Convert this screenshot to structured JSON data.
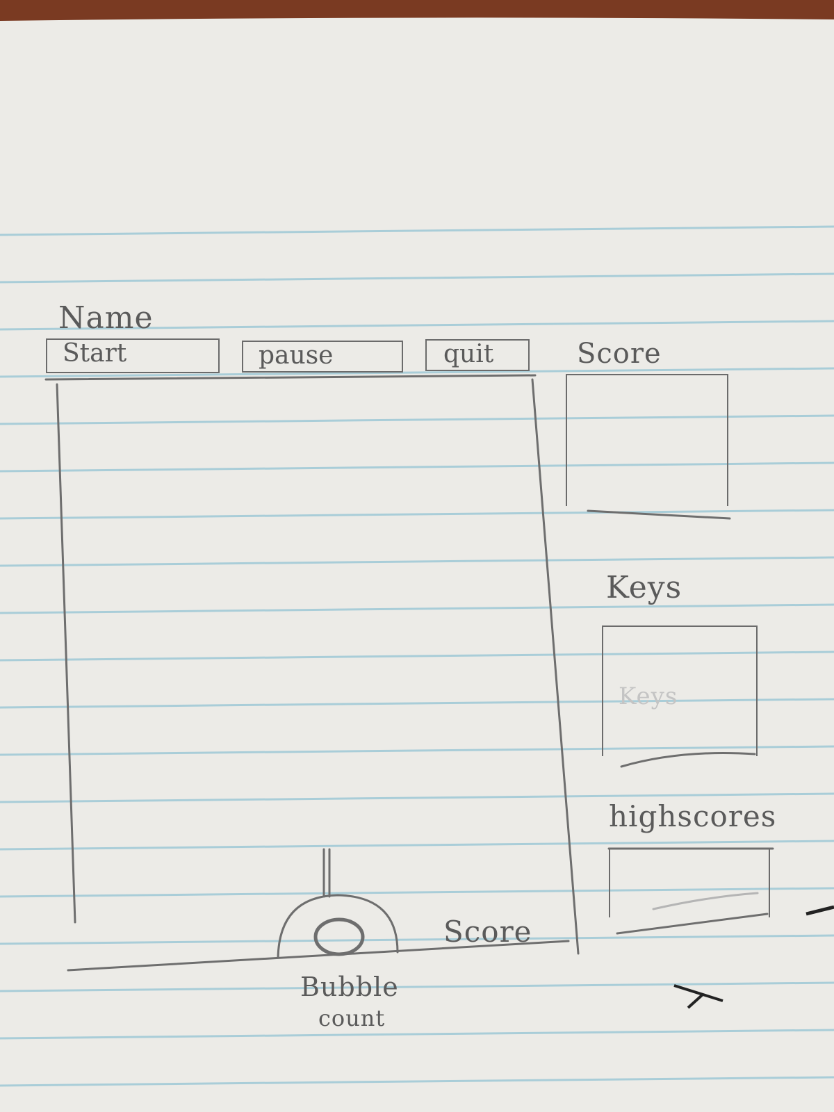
{
  "sketch": {
    "name_label": "Name",
    "buttons": {
      "start": "Start",
      "pause": "pause",
      "quit": "quit"
    },
    "sidebar": {
      "score_label": "Score",
      "keys_label": "Keys",
      "keys_inner": "Keys",
      "highscores_label": "highscores"
    },
    "bottom": {
      "score_label": "Score",
      "bubble_count_line1": "Bubble",
      "bubble_count_line2": "count"
    }
  }
}
